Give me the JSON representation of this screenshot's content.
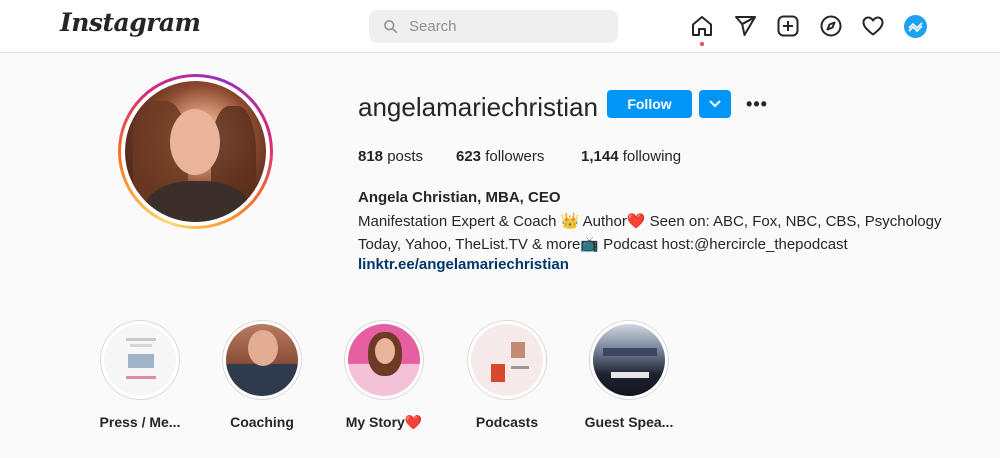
{
  "nav": {
    "logo": "Instagram",
    "search_placeholder": "Search",
    "icons": [
      "home-icon",
      "direct-message-icon",
      "new-post-icon",
      "explore-icon",
      "activity-heart-icon",
      "profile-avatar-icon"
    ]
  },
  "profile": {
    "username": "angelamariechristian",
    "follow_label": "Follow",
    "more_label": "•••",
    "stats": {
      "posts_count": "818",
      "posts_label": "posts",
      "followers_count": "623",
      "followers_label": "followers",
      "following_count": "1,144",
      "following_label": "following"
    },
    "full_name": "Angela Christian, MBA, CEO",
    "bio_lines": [
      "Manifestation Expert & Coach 👑 Author❤️ Seen on: ABC, Fox, NBC, CBS, Psychology",
      "Today, Yahoo, TheList.TV & more📺 Podcast host:@hercircle_thepodcast"
    ],
    "link": "linktr.ee/angelamariechristian"
  },
  "highlights": [
    {
      "label": "Press / Me..."
    },
    {
      "label": "Coaching"
    },
    {
      "label": "My Story❤️"
    },
    {
      "label": "Podcasts"
    },
    {
      "label": "Guest Spea..."
    }
  ],
  "colors": {
    "accent": "#0095f6",
    "link": "#00376b",
    "notification_dot": "#ed4956",
    "background": "#fafafa"
  }
}
